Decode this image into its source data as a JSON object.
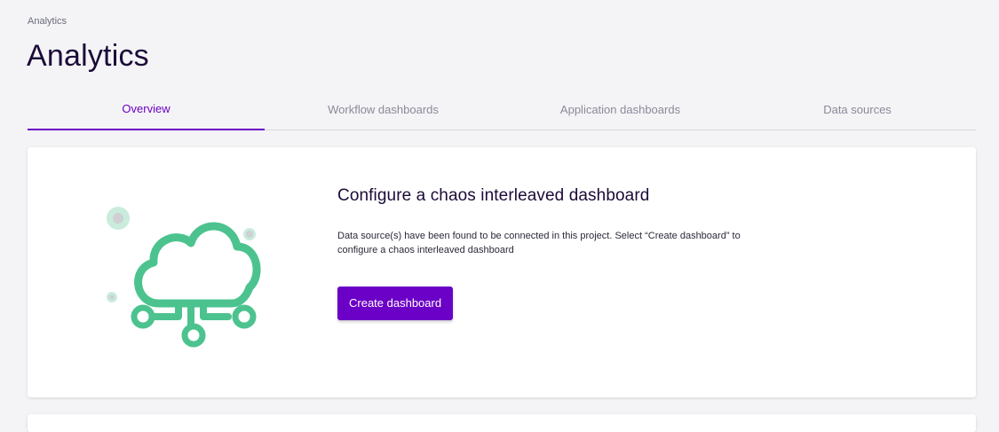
{
  "header": {
    "breadcrumb": "Analytics",
    "title": "Analytics"
  },
  "tabs": [
    {
      "label": "Overview",
      "active": true
    },
    {
      "label": "Workflow dashboards",
      "active": false
    },
    {
      "label": "Application dashboards",
      "active": false
    },
    {
      "label": "Data sources",
      "active": false
    }
  ],
  "card": {
    "title": "Configure a chaos interleaved dashboard",
    "description": "Data source(s) have been found to be connected in this project. Select “Create dashboard” to configure a chaos interleaved dashboard",
    "button_label": "Create dashboard",
    "illustration_icon": "cloud-network-icon"
  },
  "colors": {
    "accent": "#6a00c4",
    "illustration": "#4cc38f",
    "illustration_light": "#c9ecdc"
  }
}
